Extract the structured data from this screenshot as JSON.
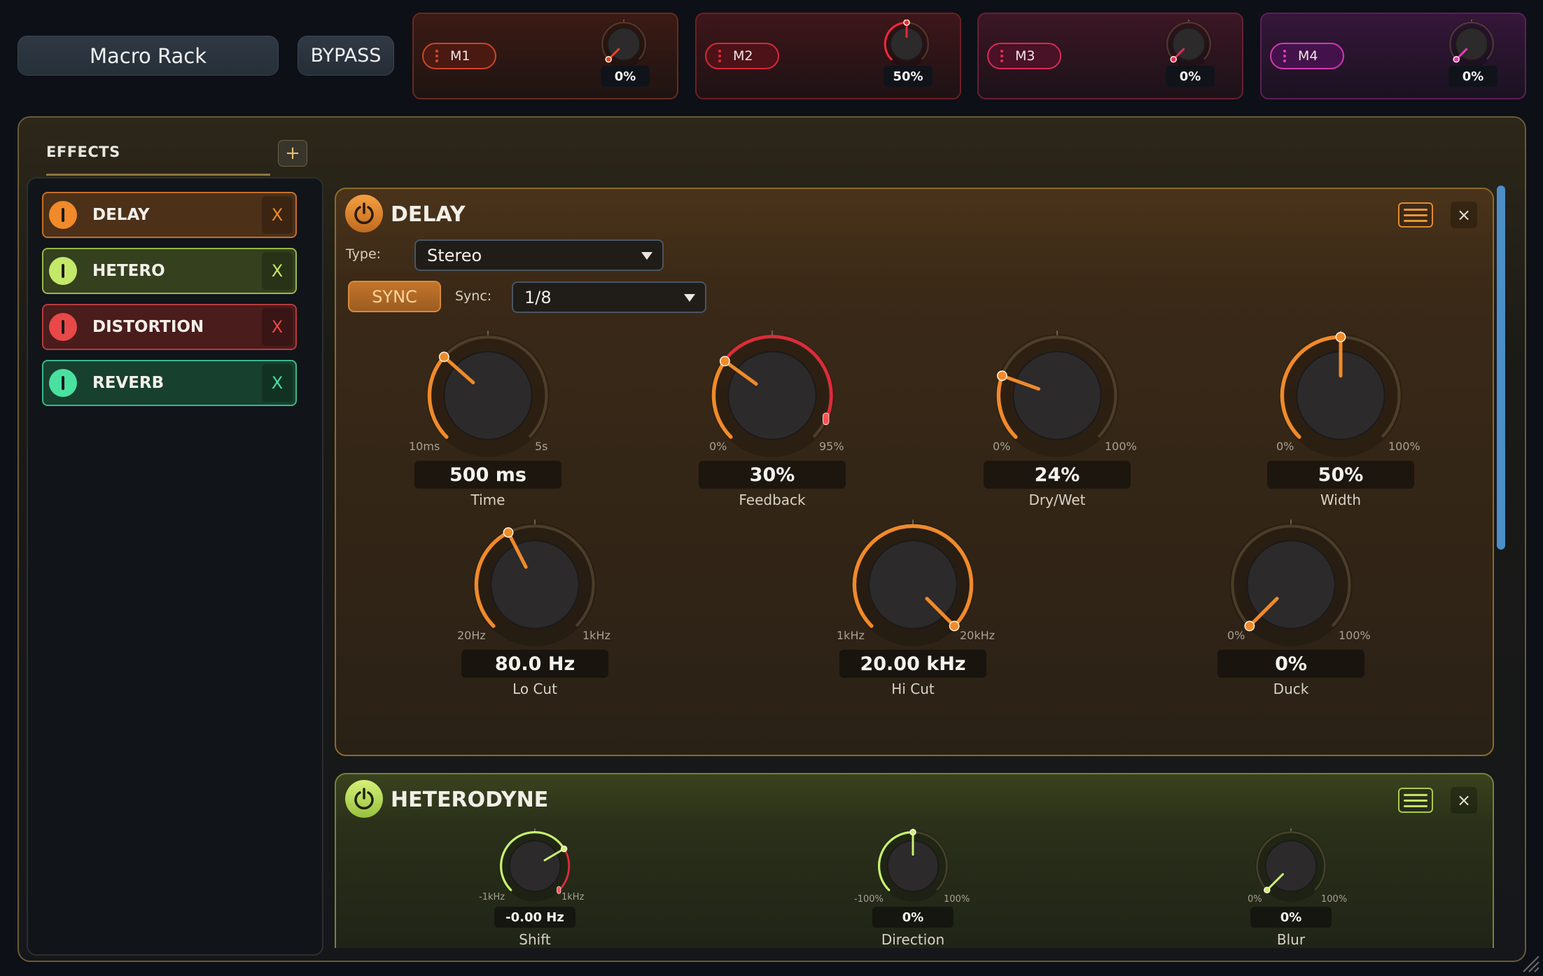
{
  "header": {
    "title": "Macro Rack",
    "bypass_label": "BYPASS"
  },
  "macros": [
    {
      "label": "M1",
      "value": "0%",
      "color": "#e04828",
      "level": 0.0
    },
    {
      "label": "M2",
      "value": "50%",
      "color": "#e8283a",
      "level": 0.5
    },
    {
      "label": "M3",
      "value": "0%",
      "color": "#e82a5a",
      "level": 0.0
    },
    {
      "label": "M4",
      "value": "0%",
      "color": "#e83ab8",
      "level": 0.0
    }
  ],
  "effects_panel": {
    "title": "EFFECTS",
    "add_label": "+",
    "items": [
      {
        "name": "DELAY",
        "remove_label": "X",
        "color": "#f08a2a"
      },
      {
        "name": "HETERO",
        "remove_label": "X",
        "color": "#c4e86a"
      },
      {
        "name": "DISTORTION",
        "remove_label": "X",
        "color": "#e84848"
      },
      {
        "name": "REVERB",
        "remove_label": "X",
        "color": "#4ae0a0"
      }
    ]
  },
  "delay": {
    "title": "DELAY",
    "close_label": "×",
    "type_label": "Type:",
    "type_value": "Stereo",
    "sync_button": "SYNC",
    "sync_label": "Sync:",
    "sync_value": "1/8",
    "accent": "#f08a2a",
    "knobs": [
      {
        "name": "Time",
        "value": "500 ms",
        "min_label": "10ms",
        "max_label": "5s",
        "level": 0.32
      },
      {
        "name": "Feedback",
        "value": "30%",
        "min_label": "0%",
        "max_label": "95%",
        "level": 0.3,
        "mod": 0.62
      },
      {
        "name": "Dry/Wet",
        "value": "24%",
        "min_label": "0%",
        "max_label": "100%",
        "level": 0.24
      },
      {
        "name": "Width",
        "value": "50%",
        "min_label": "0%",
        "max_label": "100%",
        "level": 0.5
      },
      {
        "name": "Lo Cut",
        "value": "80.0 Hz",
        "min_label": "20Hz",
        "max_label": "1kHz",
        "level": 0.4
      },
      {
        "name": "Hi Cut",
        "value": "20.00 kHz",
        "min_label": "1kHz",
        "max_label": "20kHz",
        "level": 1.0
      },
      {
        "name": "Duck",
        "value": "0%",
        "min_label": "0%",
        "max_label": "100%",
        "level": 0.0
      }
    ]
  },
  "heterodyne": {
    "title": "HETERODYNE",
    "close_label": "×",
    "accent": "#c8f070",
    "knobs": [
      {
        "name": "Shift",
        "value": "-0.00 Hz",
        "min_label": "-1kHz",
        "max_label": "1kHz",
        "level": 0.72,
        "mod": 0.28
      },
      {
        "name": "Direction",
        "value": "0%",
        "min_label": "-100%",
        "max_label": "100%",
        "level": 0.5
      },
      {
        "name": "Blur",
        "value": "0%",
        "min_label": "0%",
        "max_label": "100%",
        "level": 0.0
      }
    ]
  }
}
